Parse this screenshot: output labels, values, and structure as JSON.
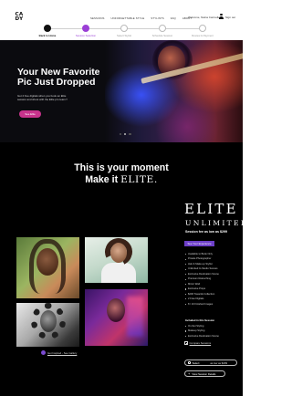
{
  "header": {
    "logo_line1": "CA",
    "logo_line2": "DY",
    "nav": [
      "Sessions",
      "Unforgettable Style",
      "Stylists",
      "FAQ",
      "About"
    ],
    "welcome": "Welcome, Naina Carmelle !",
    "signout": "Sign out"
  },
  "stepper": {
    "steps": [
      "Back to Home",
      "Session Selection",
      "Select Stylist",
      "Schedule Session",
      "Review & Payment"
    ]
  },
  "hero": {
    "title": "Your New Favorite Pic Just Dropped",
    "subtitle": "Get 2 free digitals when you book an Elite session and shoot with the Elite pro team !!",
    "cta": "See Elite"
  },
  "moment": {
    "line1": "This is your moment",
    "line2_prefix": "Make it ",
    "line2_brand": "ELITE."
  },
  "elite": {
    "logo": "ELITE",
    "sub": "UNLIMITED",
    "price": "Session fee as low as $299",
    "perks_button": "See Your Experience",
    "features": [
      "Available to Book Only",
      "Private Photographer",
      "Hair & Make-up Stylist",
      "Unlimited In-Studio Scenes",
      "Exclusive Destination Scene",
      "Premium Retouching",
      "Mirror Wall",
      "Exclusive Props",
      "$200 Towards Collection",
      "2 Free Digitals",
      "8 / 10 Finished Images"
    ],
    "included_title": "Included in this Session",
    "included": [
      "On-Set Styling",
      "Makeup Styling",
      "Exclusive Destination Scene"
    ],
    "compare": "Compare Sessions",
    "select_label": "Select",
    "select_price": "as low as $299",
    "details_label": "View Session Details"
  },
  "gallery": {
    "link": "Get Inspired - See Gallery"
  }
}
